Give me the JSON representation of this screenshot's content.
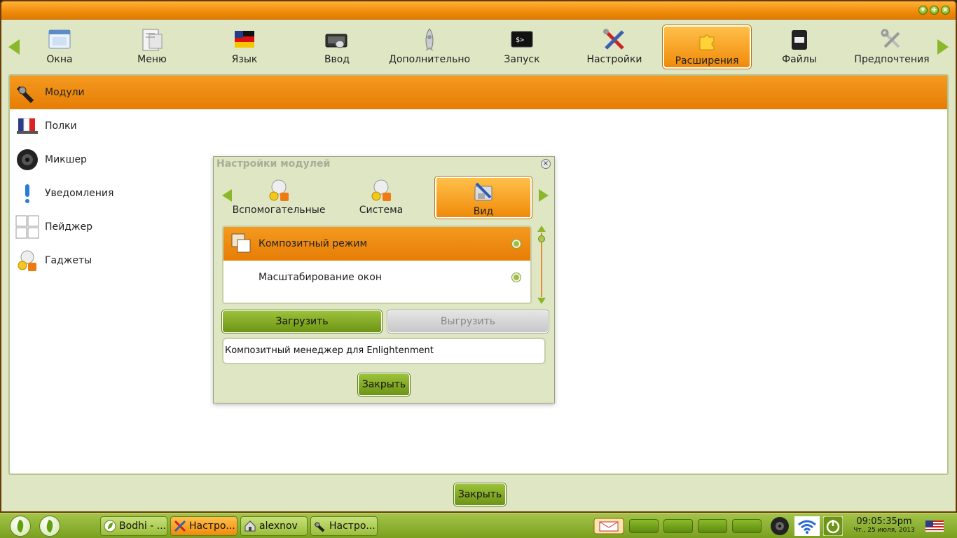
{
  "window": {
    "categories": [
      {
        "label": "Окна",
        "icon": "windows-icon"
      },
      {
        "label": "Меню",
        "icon": "menu-icon"
      },
      {
        "label": "Язык",
        "icon": "language-flag-icon"
      },
      {
        "label": "Ввод",
        "icon": "keyboard-mouse-icon"
      },
      {
        "label": "Дополнительно",
        "icon": "rocket-icon"
      },
      {
        "label": "Запуск",
        "icon": "terminal-icon"
      },
      {
        "label": "Настройки",
        "icon": "tools-icon"
      },
      {
        "label": "Расширения",
        "icon": "puzzle-icon",
        "active": true
      },
      {
        "label": "Файлы",
        "icon": "files-icon"
      },
      {
        "label": "Предпочтения",
        "icon": "wrench-icon"
      }
    ],
    "list": [
      {
        "label": "Модули",
        "icon": "plug-icon",
        "selected": true
      },
      {
        "label": "Полки",
        "icon": "shelf-icon"
      },
      {
        "label": "Микшер",
        "icon": "speaker-icon"
      },
      {
        "label": "Уведомления",
        "icon": "exclamation-icon"
      },
      {
        "label": "Пейджер",
        "icon": "pager-icon"
      },
      {
        "label": "Гаджеты",
        "icon": "gadgets-icon"
      }
    ],
    "close_label": "Закрыть"
  },
  "dialog": {
    "title": "Настройки модулей",
    "close_glyph": "×",
    "tabs": [
      {
        "label": "Вспомогательные",
        "icon": "gadgets-icon"
      },
      {
        "label": "Система",
        "icon": "gadgets-icon"
      },
      {
        "label": "Вид",
        "icon": "look-icon",
        "active": true
      }
    ],
    "modules": [
      {
        "label": "Композитный режим",
        "icon": "composite-icon",
        "selected": true
      },
      {
        "label": "Масштабирование окон",
        "icon": "",
        "selected": false
      }
    ],
    "load_label": "Загрузить",
    "unload_label": "Выгрузить",
    "description": "Композитный менеджер для Enlightenment",
    "close_label": "Закрыть"
  },
  "taskbar": {
    "tasks": [
      {
        "label": "Bodhi - ...",
        "icon": "leaf-icon"
      },
      {
        "label": "Настро...",
        "icon": "tools-icon",
        "active": true
      },
      {
        "label": "alexnov",
        "icon": "home-folder-icon"
      },
      {
        "label": "Настро...",
        "icon": "plug-icon"
      }
    ],
    "clock_time": "09:05:35pm",
    "clock_date": "Чт., 25 июля, 2013",
    "colors": {
      "accent": "#f08a0a",
      "green": "#8ab82a"
    }
  }
}
